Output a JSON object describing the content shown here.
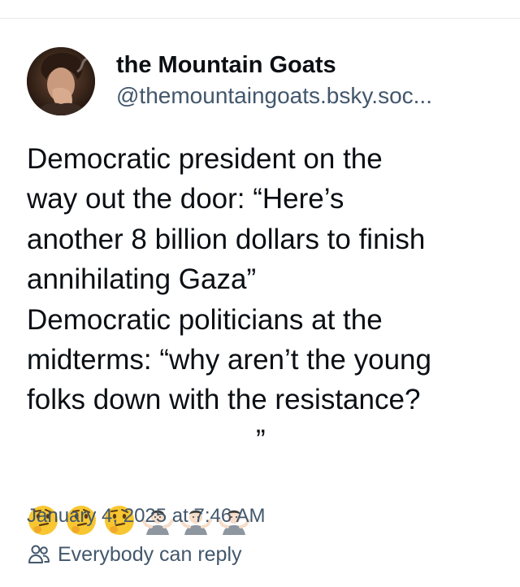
{
  "post": {
    "author": {
      "display_name": "the Mountain Goats",
      "handle": "@themountaingoats.bsky.soc...",
      "avatar_icon": "avatar-photo"
    },
    "text_lines": [
      "Democratic president on the",
      "way out the door: “Here’s",
      "another 8 billion dollars to finish",
      "annihilating Gaza”",
      "Democratic politicians at the",
      "midterms: “why aren’t the young",
      "folks down with the resistance?"
    ],
    "emojis": [
      "thinking-face",
      "thinking-face",
      "thinking-face",
      "person-shrugging",
      "person-shrugging",
      "person-shrugging"
    ],
    "emoji_tail": "”",
    "timestamp": "January 4, 2025 at 7:46 AM",
    "reply_setting": {
      "icon": "people-icon",
      "label": "Everybody can reply"
    }
  },
  "colors": {
    "text": "#0b0f14",
    "muted": "#42576c",
    "divider": "#e6e9ed"
  }
}
